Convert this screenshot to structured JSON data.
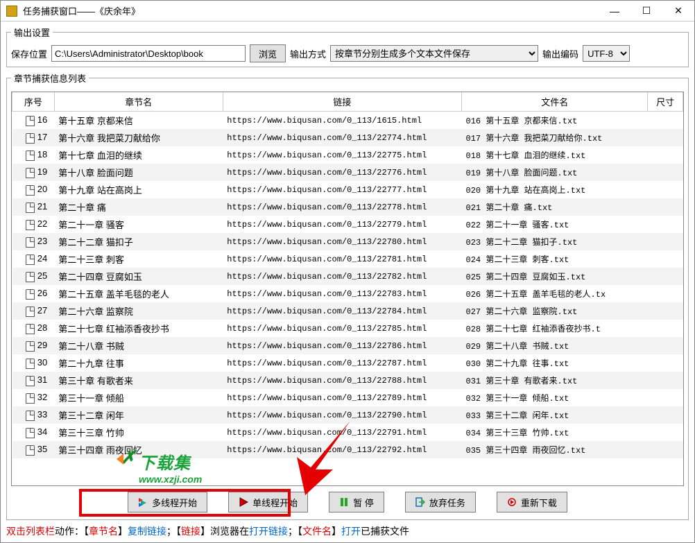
{
  "window": {
    "title": "任务捕获窗口——《庆余年》"
  },
  "output_settings": {
    "legend": "输出设置",
    "save_label": "保存位置",
    "save_path": "C:\\Users\\Administrator\\Desktop\\book",
    "browse": "浏览",
    "mode_label": "输出方式",
    "mode_selected": "按章节分别生成多个文本文件保存",
    "encoding_label": "输出编码",
    "encoding_selected": "UTF-8"
  },
  "list": {
    "legend": "章节捕获信息列表",
    "headers": {
      "no": "序号",
      "chapter": "章节名",
      "link": "链接",
      "file": "文件名",
      "size": "尺寸"
    },
    "rows": [
      {
        "no": "16",
        "chapter": "第十五章 京都来信",
        "link": "https://www.biqusan.com/0_113/1615.html",
        "file": "016 第十五章 京都来信.txt"
      },
      {
        "no": "17",
        "chapter": "第十六章 我把菜刀献给你",
        "link": "https://www.biqusan.com/0_113/22774.html",
        "file": "017 第十六章 我把菜刀献给你.txt"
      },
      {
        "no": "18",
        "chapter": "第十七章 血泪的继续",
        "link": "https://www.biqusan.com/0_113/22775.html",
        "file": "018 第十七章 血泪的继续.txt"
      },
      {
        "no": "19",
        "chapter": "第十八章 脸面问题",
        "link": "https://www.biqusan.com/0_113/22776.html",
        "file": "019 第十八章 脸面问题.txt"
      },
      {
        "no": "20",
        "chapter": "第十九章 站在高岗上",
        "link": "https://www.biqusan.com/0_113/22777.html",
        "file": "020 第十九章 站在高岗上.txt"
      },
      {
        "no": "21",
        "chapter": "第二十章 痛",
        "link": "https://www.biqusan.com/0_113/22778.html",
        "file": "021 第二十章 痛.txt"
      },
      {
        "no": "22",
        "chapter": "第二十一章 骚客",
        "link": "https://www.biqusan.com/0_113/22779.html",
        "file": "022 第二十一章 骚客.txt"
      },
      {
        "no": "23",
        "chapter": "第二十二章 猫扣子",
        "link": "https://www.biqusan.com/0_113/22780.html",
        "file": "023 第二十二章 猫扣子.txt"
      },
      {
        "no": "24",
        "chapter": "第二十三章 刺客",
        "link": "https://www.biqusan.com/0_113/22781.html",
        "file": "024 第二十三章 刺客.txt"
      },
      {
        "no": "25",
        "chapter": "第二十四章 豆腐如玉",
        "link": "https://www.biqusan.com/0_113/22782.html",
        "file": "025 第二十四章 豆腐如玉.txt"
      },
      {
        "no": "26",
        "chapter": "第二十五章 盖羊毛毯的老人",
        "link": "https://www.biqusan.com/0_113/22783.html",
        "file": "026 第二十五章 盖羊毛毯的老人.tx"
      },
      {
        "no": "27",
        "chapter": "第二十六章 监察院",
        "link": "https://www.biqusan.com/0_113/22784.html",
        "file": "027 第二十六章 监察院.txt"
      },
      {
        "no": "28",
        "chapter": "第二十七章 红袖添香夜抄书",
        "link": "https://www.biqusan.com/0_113/22785.html",
        "file": "028 第二十七章 红袖添香夜抄书.t"
      },
      {
        "no": "29",
        "chapter": "第二十八章 书贼",
        "link": "https://www.biqusan.com/0_113/22786.html",
        "file": "029 第二十八章 书贼.txt"
      },
      {
        "no": "30",
        "chapter": "第二十九章 往事",
        "link": "https://www.biqusan.com/0_113/22787.html",
        "file": "030 第二十九章 往事.txt"
      },
      {
        "no": "31",
        "chapter": "第三十章 有歌者来",
        "link": "https://www.biqusan.com/0_113/22788.html",
        "file": "031 第三十章 有歌者来.txt"
      },
      {
        "no": "32",
        "chapter": "第三十一章 倾船",
        "link": "https://www.biqusan.com/0_113/22789.html",
        "file": "032 第三十一章 倾船.txt"
      },
      {
        "no": "33",
        "chapter": "第三十二章 闲年",
        "link": "https://www.biqusan.com/0_113/22790.html",
        "file": "033 第三十二章 闲年.txt"
      },
      {
        "no": "34",
        "chapter": "第三十三章 竹帅",
        "link": "https://www.biqusan.com/0_113/22791.html",
        "file": "034 第三十三章 竹帅.txt"
      },
      {
        "no": "35",
        "chapter": "第三十四章 雨夜回忆",
        "link": "https://www.biqusan.com/0_113/22792.html",
        "file": "035 第三十四章 雨夜回忆.txt"
      }
    ]
  },
  "buttons": {
    "multi": "多线程开始",
    "single": "单线程开始",
    "pause": "暂 停",
    "abandon": "放弃任务",
    "redownload": "重新下载"
  },
  "hint": {
    "p1": "双击列表栏",
    "p2": "动作：【",
    "p3": "章节名",
    "p4": "】",
    "p5": "复制链接",
    "p6": "；【",
    "p7": "链接",
    "p8": "】浏览器在",
    "p9": "打开链接",
    "p10": "；【",
    "p11": "文件名",
    "p12": "】",
    "p13": "打开",
    "p14": "已捕获文件"
  },
  "watermark": {
    "text": "下载集",
    "url": "www.xzji.com"
  }
}
